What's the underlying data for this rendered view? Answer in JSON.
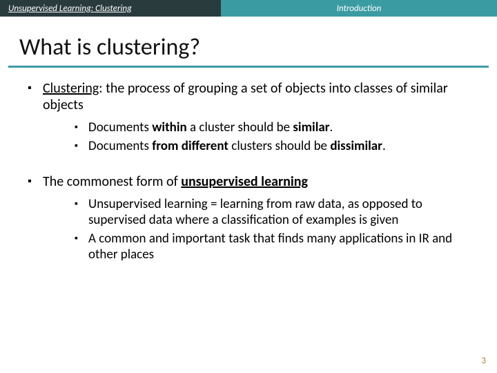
{
  "header": {
    "left": "Unsupervised Learning: Clustering",
    "right": "Introduction"
  },
  "title": "What is clustering?",
  "b1": {
    "lead": "Clustering",
    "rest": ": the process of grouping a set of objects into classes of similar objects",
    "sub1_a": "Documents ",
    "sub1_b": "within",
    "sub1_c": " a cluster should be ",
    "sub1_d": "similar",
    "sub1_e": ".",
    "sub2_a": "Documents ",
    "sub2_b": "from different",
    "sub2_c": " clusters should be ",
    "sub2_d": "dissimilar",
    "sub2_e": "."
  },
  "b2": {
    "a": "The commonest form of ",
    "b": "unsupervised learning",
    "sub1": "Unsupervised learning = learning from raw data, as opposed to supervised data where a classification of examples is given",
    "sub2": "A common and important task that finds many applications in IR and other places"
  },
  "pagenum": "3"
}
